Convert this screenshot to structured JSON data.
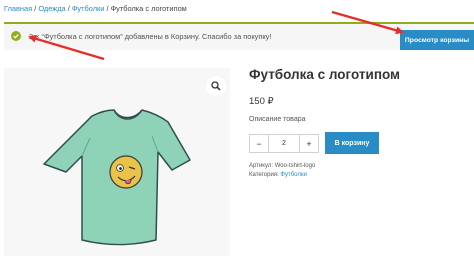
{
  "breadcrumb": {
    "items": [
      "Главная",
      "Одежда",
      "Футболки"
    ],
    "separator": "/",
    "current": "Футболка с логотипом"
  },
  "notice": {
    "message": "2 × “Футболка с логотипом” добавлены в Корзину. Спасибо за покупку!",
    "button_label": "Просмотр корзины",
    "accent_color": "#8fae1b"
  },
  "product": {
    "title": "Футболка с логотипом",
    "price": "150 ₽",
    "short_description": "Описание товара",
    "quantity": "2",
    "minus_label": "−",
    "plus_label": "+",
    "add_to_cart_label": "В корзину",
    "sku_label": "Артикул:",
    "sku_value": "Woo-tshirt-logo",
    "category_label": "Категория:",
    "category_value": "Футболки"
  },
  "icons": {
    "notice": "check-circle-icon",
    "zoom": "magnifier-icon"
  },
  "colors": {
    "link": "#2a8cc4",
    "button": "#2a8cc4",
    "annotation_arrows": "#e4302b",
    "shirt": "#8ed3b7"
  }
}
